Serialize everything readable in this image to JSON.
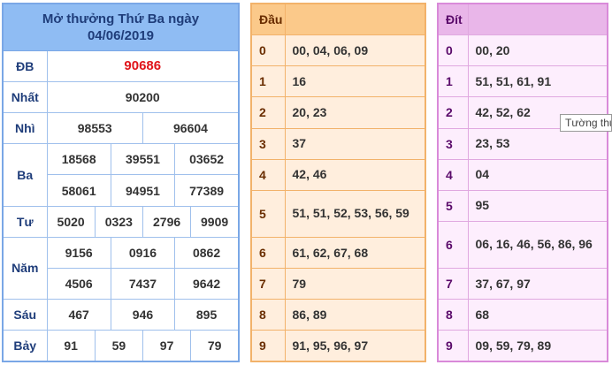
{
  "results": {
    "title": "Mở thưởng Thứ Ba ngày",
    "date": "04/06/2019",
    "rows": {
      "db": {
        "label": "ĐB",
        "values": [
          "90686"
        ]
      },
      "nhat": {
        "label": "Nhất",
        "values": [
          "90200"
        ]
      },
      "nhi": {
        "label": "Nhì",
        "values": [
          "98553",
          "96604"
        ]
      },
      "ba": {
        "label": "Ba",
        "values": [
          "18568",
          "39551",
          "03652",
          "58061",
          "94951",
          "77389"
        ]
      },
      "tu": {
        "label": "Tư",
        "values": [
          "5020",
          "0323",
          "2796",
          "9909"
        ]
      },
      "nam": {
        "label": "Năm",
        "values": [
          "9156",
          "0916",
          "0862",
          "4506",
          "7437",
          "9642"
        ]
      },
      "sau": {
        "label": "Sáu",
        "values": [
          "467",
          "946",
          "895"
        ]
      },
      "bay": {
        "label": "Bảy",
        "values": [
          "91",
          "59",
          "97",
          "79"
        ]
      }
    }
  },
  "dau": {
    "header": "Đầu",
    "rows": [
      {
        "key": "0",
        "values": "00, 04, 06, 09"
      },
      {
        "key": "1",
        "values": "16"
      },
      {
        "key": "2",
        "values": "20, 23"
      },
      {
        "key": "3",
        "values": "37"
      },
      {
        "key": "4",
        "values": "42, 46"
      },
      {
        "key": "5",
        "values": "51, 51, 52, 53, 56, 59"
      },
      {
        "key": "6",
        "values": "61, 62, 67, 68"
      },
      {
        "key": "7",
        "values": "79"
      },
      {
        "key": "8",
        "values": "86, 89"
      },
      {
        "key": "9",
        "values": "91, 95, 96, 97"
      }
    ]
  },
  "dit": {
    "header": "Đít",
    "rows": [
      {
        "key": "0",
        "values": "00, 20"
      },
      {
        "key": "1",
        "values": "51, 51, 61, 91"
      },
      {
        "key": "2",
        "values": "42, 52, 62"
      },
      {
        "key": "3",
        "values": "23, 53"
      },
      {
        "key": "4",
        "values": "04"
      },
      {
        "key": "5",
        "values": "95"
      },
      {
        "key": "6",
        "values": "06, 16, 46, 56, 86, 96"
      },
      {
        "key": "7",
        "values": "37, 67, 97"
      },
      {
        "key": "8",
        "values": "68"
      },
      {
        "key": "9",
        "values": "09, 59, 79, 89"
      }
    ]
  },
  "tooltip": {
    "text": "Tường thu"
  },
  "colors": {
    "special_prize": "#e0141a",
    "results_header": "#8fbcf3",
    "dau_header": "#fbc98a",
    "dit_header": "#e9b6e9"
  }
}
